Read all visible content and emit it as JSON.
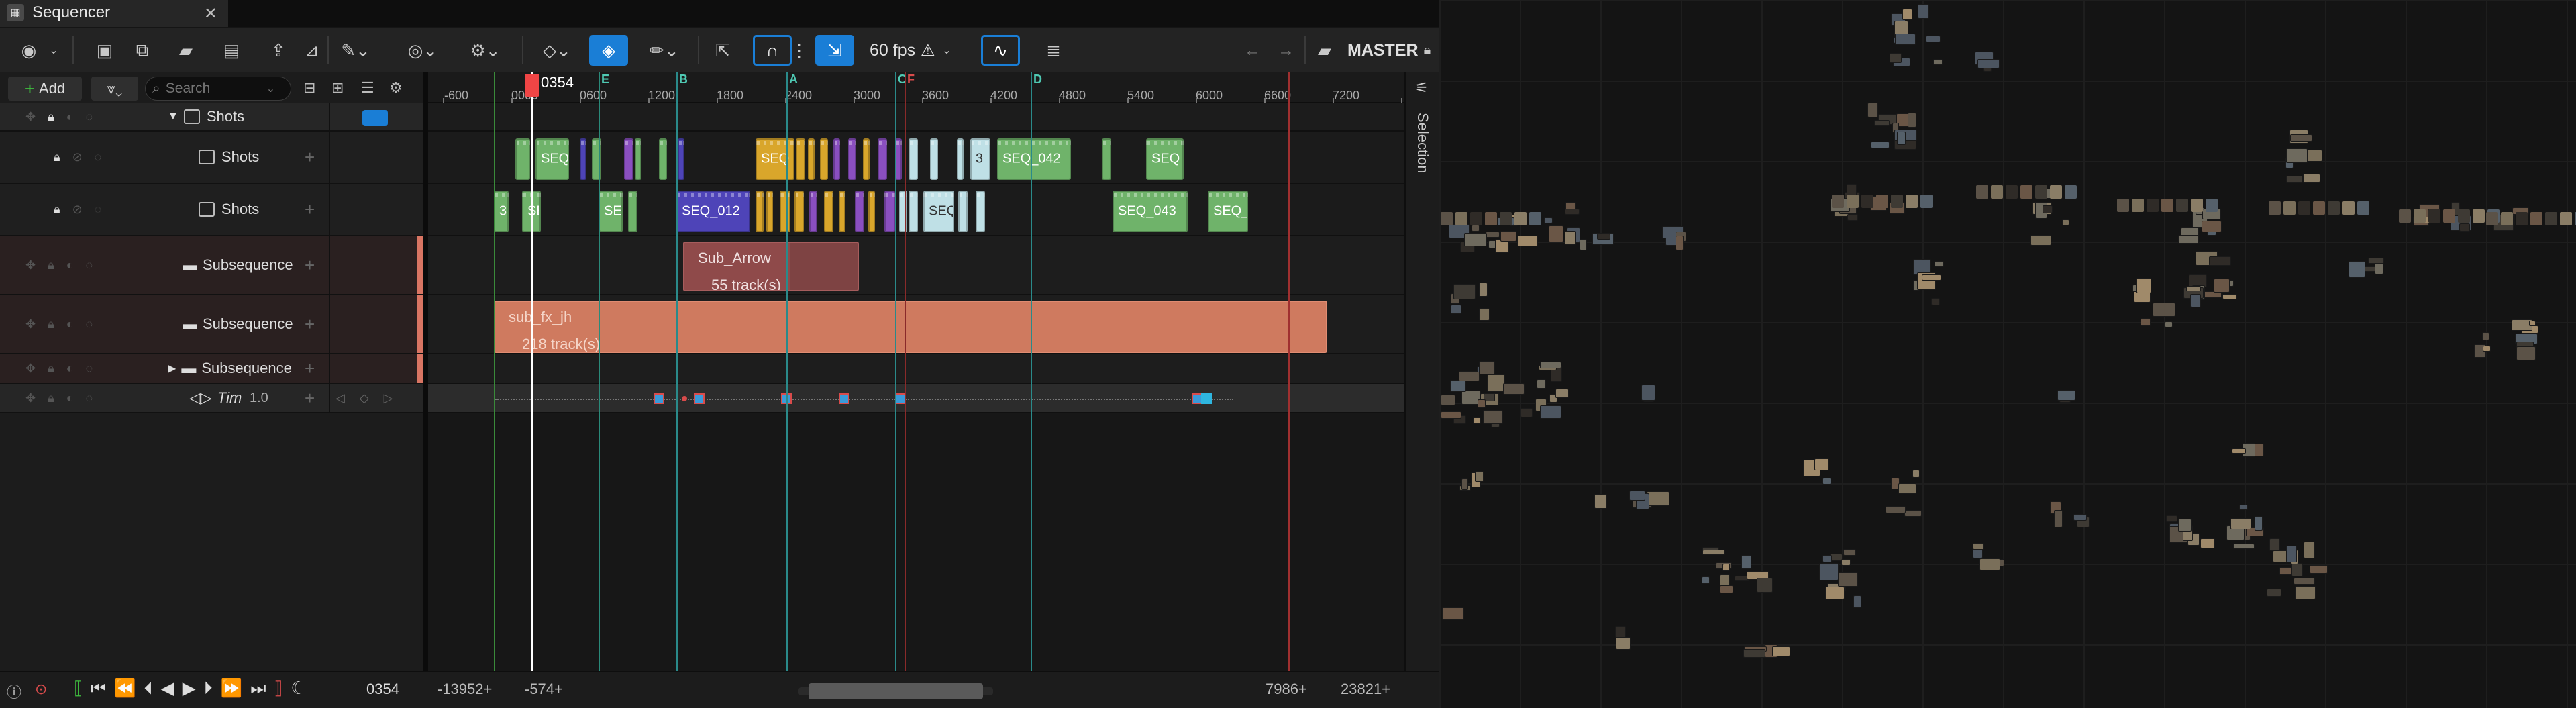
{
  "tab": {
    "title": "Sequencer",
    "close": "✕"
  },
  "toolbar": {
    "fps": "60 fps",
    "master": "MASTER",
    "warning": "⚠",
    "back": "←",
    "forward": "→"
  },
  "outliner": {
    "add_label": "Add",
    "search_placeholder": "Search",
    "rows": [
      {
        "label": "Shots"
      },
      {
        "label": "Shots"
      },
      {
        "label": "Shots"
      },
      {
        "label": "Subsequence"
      },
      {
        "label": "Subsequence"
      },
      {
        "label": "Subsequence"
      },
      {
        "label": "Tim",
        "value": "1.0"
      }
    ]
  },
  "ruler": {
    "ticks": [
      "-600",
      "0000",
      "0600",
      "1200",
      "1800",
      "2400",
      "3000",
      "3600",
      "4200",
      "4800",
      "5400",
      "6000",
      "6600",
      "7200",
      "78"
    ],
    "playhead_frame": "0354",
    "markers": [
      "A",
      "B",
      "C",
      "D",
      "E",
      "F"
    ]
  },
  "sections": {
    "seq_012": "SEQ_012",
    "seq_042": "SEQ_042",
    "seq_043": "SEQ_043",
    "seq": "SEQ",
    "seq_trunc": "SEQ_",
    "s3": "3",
    "sub_arrow": "Sub_Arrow",
    "sub_arrow_count": "55 track(s)",
    "sub_fx": "sub_fx_jh",
    "sub_fx_count": "218 track(s)"
  },
  "selection_panel": {
    "label": "Selection"
  },
  "status": {
    "frame": "0354",
    "range_start": "-13952+",
    "view_start": "-574+",
    "view_end": "7986+",
    "range_end": "23821+"
  },
  "colors": {
    "accent": "#1a7ed6",
    "shot_green": "#6fb36a",
    "shot_yellow": "#d9a62b",
    "shot_purple": "#8a4fc0",
    "shot_blue": "#4e44b8",
    "shot_light": "#bfe0e6",
    "sub_red": "#8f4a4a",
    "sub_salmon": "#d97a60"
  }
}
